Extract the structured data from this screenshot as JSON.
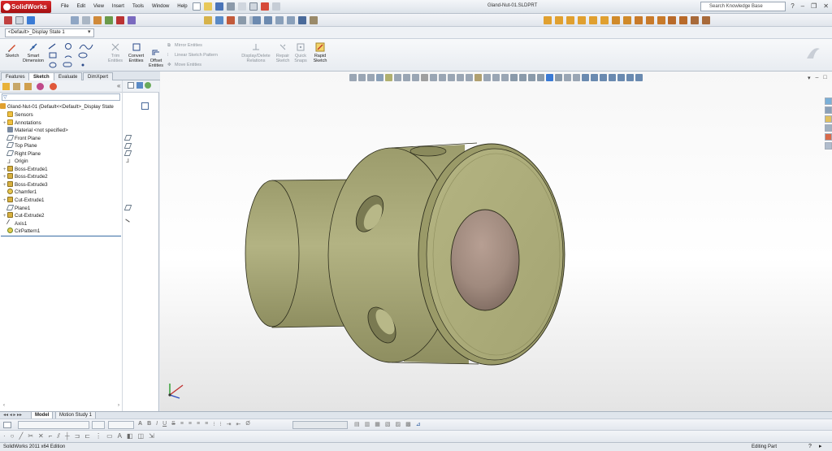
{
  "app": {
    "name": "SolidWorks",
    "doc_title": "Gland-Nut-01.SLDPRT"
  },
  "menu": [
    "File",
    "Edit",
    "View",
    "Insert",
    "Tools",
    "Window",
    "Help"
  ],
  "search": {
    "placeholder": "Search Knowledge Base"
  },
  "config": {
    "selected": "<Default>_Display State 1"
  },
  "commands": {
    "sketch": "Sketch",
    "smart_dimension_1": "Smart",
    "smart_dimension_2": "Dimension",
    "trim_1": "Trim",
    "trim_2": "Entities",
    "convert_1": "Convert",
    "convert_2": "Entities",
    "offset_1": "Offset",
    "offset_2": "Entities",
    "mirror": "Mirror Entities",
    "linear_pattern": "Linear Sketch Pattern",
    "move": "Move Entities",
    "display_delete_1": "Display/Delete",
    "display_delete_2": "Relations",
    "repair_1": "Repair",
    "repair_2": "Sketch",
    "quick_snaps_1": "Quick",
    "quick_snaps_2": "Snaps",
    "rapid_1": "Rapid",
    "rapid_2": "Sketch"
  },
  "tabs": [
    "Features",
    "Sketch",
    "Evaluate",
    "DimXpert"
  ],
  "active_tab": "Sketch",
  "tree": {
    "root": "Gland-Nut-01  (Default<<Default>_Display State",
    "items": [
      {
        "label": "Sensors",
        "icon": "sensor-icon"
      },
      {
        "label": "Annotations",
        "icon": "annotations-icon"
      },
      {
        "label": "Material <not specified>",
        "icon": "material-icon"
      },
      {
        "label": "Front Plane",
        "icon": "plane-icon"
      },
      {
        "label": "Top Plane",
        "icon": "plane-icon"
      },
      {
        "label": "Right Plane",
        "icon": "plane-icon"
      },
      {
        "label": "Origin",
        "icon": "origin-icon"
      },
      {
        "label": "Boss-Extrude1",
        "icon": "extrude-icon"
      },
      {
        "label": "Boss-Extrude2",
        "icon": "extrude-icon"
      },
      {
        "label": "Boss-Extrude3",
        "icon": "extrude-icon"
      },
      {
        "label": "Chamfer1",
        "icon": "chamfer-icon"
      },
      {
        "label": "Cut-Extrude1",
        "icon": "cut-icon"
      },
      {
        "label": "Plane1",
        "icon": "plane-icon"
      },
      {
        "label": "Cut-Extrude2",
        "icon": "cut-icon"
      },
      {
        "label": "Axis1",
        "icon": "axis-icon"
      },
      {
        "label": "CirPattern1",
        "icon": "pattern-icon"
      }
    ]
  },
  "bottom_tabs": [
    "Model",
    "Motion Study 1"
  ],
  "active_bottom_tab": "Model",
  "status": {
    "left": "SolidWorks 2011 x64 Edition",
    "right": "Editing Part"
  },
  "colors": {
    "brand_red": "#c0181a",
    "part": "#b9b98a",
    "bore": "#a08a80"
  }
}
